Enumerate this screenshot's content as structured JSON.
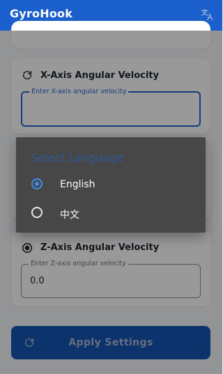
{
  "app": {
    "title": "GyroHook",
    "icon": "translate-icon"
  },
  "cards": {
    "x_axis": {
      "title": "X-Axis Angular Velocity",
      "icon": "refresh-cw-icon",
      "label": "Enter X-axis angular velocity",
      "value": ""
    },
    "z_axis": {
      "title": "Z-Axis Angular Velocity",
      "icon": "radio-target-icon",
      "label": "Enter Z-axis angular velocity",
      "value": "0.0"
    }
  },
  "apply_button": {
    "label": "Apply Settings",
    "icon": "refresh-cw-icon"
  },
  "language_dialog": {
    "title": "Select Language",
    "options": [
      {
        "label": "English",
        "selected": true
      },
      {
        "label": "中文",
        "selected": false
      }
    ]
  },
  "colors": {
    "primary": "#1a5fcc",
    "dialog_bg": "#474747",
    "radio_selected": "#3d8ef5"
  }
}
